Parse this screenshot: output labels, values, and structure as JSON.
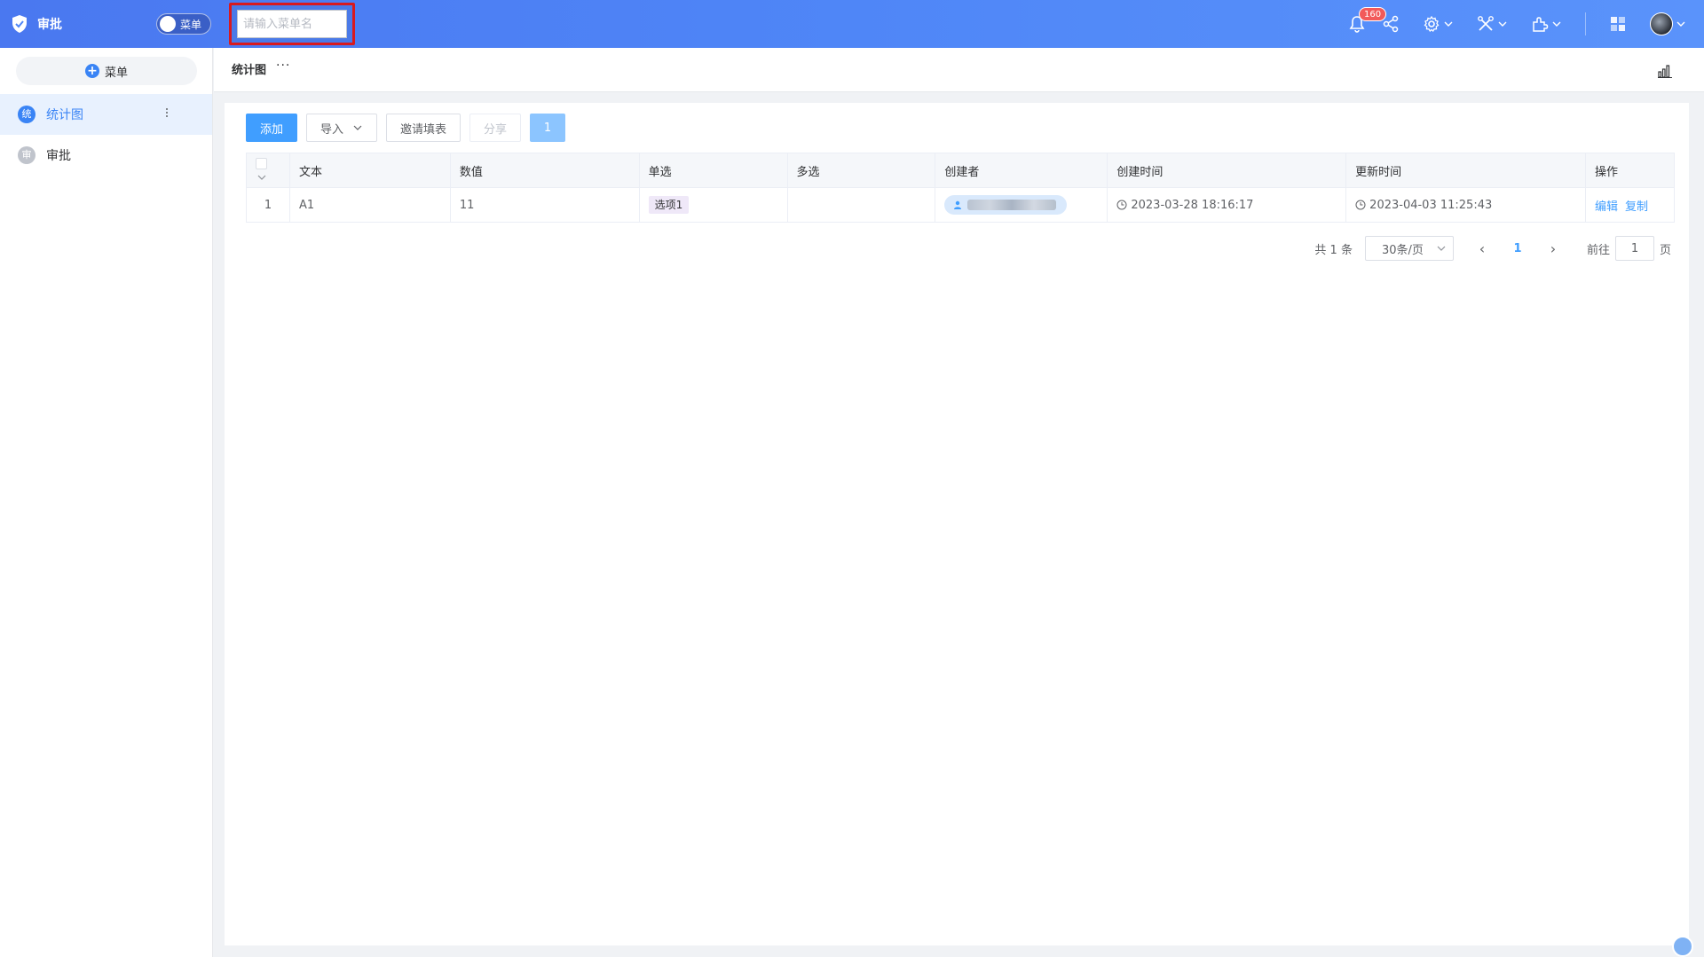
{
  "header": {
    "app_title": "审批",
    "menu_toggle_label": "菜单",
    "search_placeholder": "请输入菜单名",
    "notification_count": "160"
  },
  "sidebar": {
    "add_button_label": "菜单",
    "items": [
      {
        "icon_text": "统",
        "label": "统计图",
        "active": true
      },
      {
        "icon_text": "审",
        "label": "审批",
        "active": false
      }
    ]
  },
  "tabbar": {
    "title": "统计图",
    "more": "···"
  },
  "toolbar": {
    "add": "添加",
    "import": "导入",
    "invite": "邀请填表",
    "share": "分享",
    "count": "1"
  },
  "table": {
    "columns": [
      "文本",
      "数值",
      "单选",
      "多选",
      "创建者",
      "创建时间",
      "更新时间",
      "操作"
    ],
    "rows": [
      {
        "index": "1",
        "text": "A1",
        "number": "11",
        "single": "选项1",
        "multi": "",
        "created_at": "2023-03-28 18:16:17",
        "updated_at": "2023-04-03 11:25:43",
        "edit": "编辑",
        "copy": "复制"
      }
    ]
  },
  "pager": {
    "total": "共 1 条",
    "page_size": "30条/页",
    "current": "1",
    "goto_label": "前往",
    "goto_value": "1",
    "page_suffix": "页"
  },
  "colors": {
    "header": "#4f86f7",
    "primary": "#409eff",
    "active_bg": "#e8f1fe"
  },
  "icons": [
    "shield-icon",
    "bell-icon",
    "share-icon",
    "gear-icon",
    "tools-icon",
    "plugin-icon",
    "apps-icon",
    "chart-icon",
    "user-icon",
    "clock-icon"
  ]
}
